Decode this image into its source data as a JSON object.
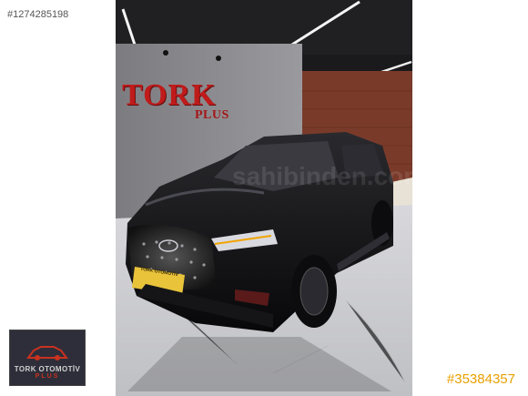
{
  "listing": {
    "id_tag": "#1274285198",
    "listing_number": "#35384357"
  },
  "showroom": {
    "sign_main": "TORK",
    "sign_sub": "PLUS"
  },
  "plate": {
    "text": "TORK OTOMOTİV"
  },
  "dealer_logo": {
    "name": "TORK OTOMOTİV",
    "sub": "PLUS"
  },
  "watermark": {
    "text": "sahibinden.com"
  },
  "colors": {
    "accent": "#e8a000",
    "sign_red": "#c01b1b"
  }
}
